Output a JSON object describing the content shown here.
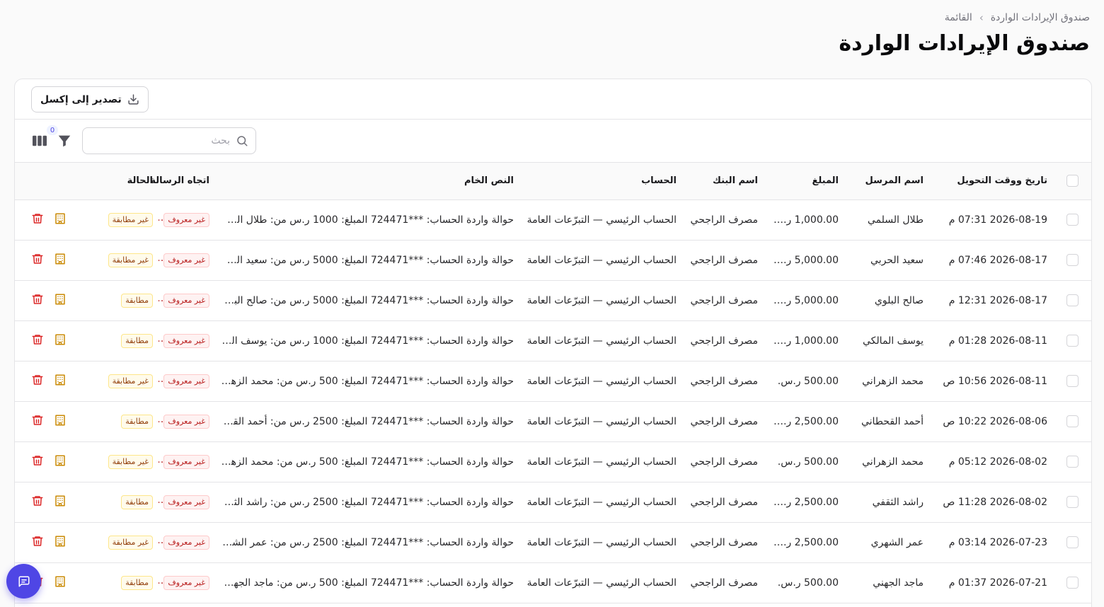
{
  "breadcrumb": {
    "parent": "صندوق الإيرادات الواردة",
    "separator": "›",
    "current": "القائمة"
  },
  "page_title": "صندوق الإيرادات الواردة",
  "toolbar": {
    "export_label": "تصدير إلى إكسل",
    "search_placeholder": "بحث",
    "filter_count": "0"
  },
  "table": {
    "headers": {
      "date": "تاريخ ووقت التحويل",
      "sender": "اسم المرسل",
      "amount": "المبلغ",
      "bank": "اسم البنك",
      "account": "الحساب",
      "raw": "النص الخام",
      "direction": "اتجاه الرسالة",
      "status": "الحالة"
    },
    "rows": [
      {
        "date": "2026-08-19 07:31 م",
        "sender": "طلال السلمي",
        "amount": "1,000.00 ر.س.",
        "bank": "مصرف الراجحي",
        "account": "الحساب الرئيسي — التبرّعات العامة",
        "raw": "حوالة واردة الحساب: ***724471 المبلغ: 1000 ر.س من: طلال السل...",
        "direction": "غير معروف",
        "status": "غير مطابقة",
        "status_kind": "match"
      },
      {
        "date": "2026-08-17 07:46 م",
        "sender": "سعيد الحربي",
        "amount": "5,000.00 ر.س.",
        "bank": "مصرف الراجحي",
        "account": "الحساب الرئيسي — التبرّعات العامة",
        "raw": "حوالة واردة الحساب: ***724471 المبلغ: 5000 ر.س من: سعيد الحر...",
        "direction": "غير معروف",
        "status": "غير مطابقة",
        "status_kind": "match"
      },
      {
        "date": "2026-08-17 12:31 م",
        "sender": "صالح البلوي",
        "amount": "5,000.00 ر.س.",
        "bank": "مصرف الراجحي",
        "account": "الحساب الرئيسي — التبرّعات العامة",
        "raw": "حوالة واردة الحساب: ***724471 المبلغ: 5000 ر.س من: صالح البل...",
        "direction": "غير معروف",
        "status": "مطابقة",
        "status_kind": "match"
      },
      {
        "date": "2026-08-11 01:28 م",
        "sender": "يوسف المالكي",
        "amount": "1,000.00 ر.س.",
        "bank": "مصرف الراجحي",
        "account": "الحساب الرئيسي — التبرّعات العامة",
        "raw": "حوالة واردة الحساب: ***724471 المبلغ: 1000 ر.س من: يوسف الما...",
        "direction": "غير معروف",
        "status": "مطابقة",
        "status_kind": "match"
      },
      {
        "date": "2026-08-11 10:56 ص",
        "sender": "محمد الزهراني",
        "amount": "500.00 ر.س.",
        "bank": "مصرف الراجحي",
        "account": "الحساب الرئيسي — التبرّعات العامة",
        "raw": "حوالة واردة الحساب: ***724471 المبلغ: 500 ر.س من: محمد الزهر...",
        "direction": "غير معروف",
        "status": "غير مطابقة",
        "status_kind": "match"
      },
      {
        "date": "2026-08-06 10:22 ص",
        "sender": "أحمد القحطاني",
        "amount": "2,500.00 ر.س.",
        "bank": "مصرف الراجحي",
        "account": "الحساب الرئيسي — التبرّعات العامة",
        "raw": "حوالة واردة الحساب: ***724471 المبلغ: 2500 ر.س من: أحمد القح...",
        "direction": "غير معروف",
        "status": "مطابقة",
        "status_kind": "match"
      },
      {
        "date": "2026-08-02 05:12 م",
        "sender": "محمد الزهراني",
        "amount": "500.00 ر.س.",
        "bank": "مصرف الراجحي",
        "account": "الحساب الرئيسي — التبرّعات العامة",
        "raw": "حوالة واردة الحساب: ***724471 المبلغ: 500 ر.س من: محمد الزهر...",
        "direction": "غير معروف",
        "status": "غير مطابقة",
        "status_kind": "match"
      },
      {
        "date": "2026-08-02 11:28 ص",
        "sender": "راشد الثقفي",
        "amount": "2,500.00 ر.س.",
        "bank": "مصرف الراجحي",
        "account": "الحساب الرئيسي — التبرّعات العامة",
        "raw": "حوالة واردة الحساب: ***724471 المبلغ: 2500 ر.س من: راشد الثق...",
        "direction": "غير معروف",
        "status": "مطابقة",
        "status_kind": "match"
      },
      {
        "date": "2026-07-23 03:14 م",
        "sender": "عمر الشهري",
        "amount": "2,500.00 ر.س.",
        "bank": "مصرف الراجحي",
        "account": "الحساب الرئيسي — التبرّعات العامة",
        "raw": "حوالة واردة الحساب: ***724471 المبلغ: 2500 ر.س من: عمر الشهر...",
        "direction": "غير معروف",
        "status": "غير مطابقة",
        "status_kind": "match"
      },
      {
        "date": "2026-07-21 01:37 م",
        "sender": "ماجد الجهني",
        "amount": "500.00 ر.س.",
        "bank": "مصرف الراجحي",
        "account": "الحساب الرئيسي — التبرّعات العامة",
        "raw": "حوالة واردة الحساب: ***724471 المبلغ: 500 ر.س من: ماجد الجهن...",
        "direction": "غير معروف",
        "status": "مطابقة",
        "status_kind": "match"
      }
    ]
  },
  "colors": {
    "accent": "#4f46e5",
    "delete_icon": "#dc2626",
    "building_icon": "#ca8a04"
  },
  "icons": {
    "export": "download-icon",
    "search": "search-icon",
    "filter": "filter-icon",
    "columns": "columns-icon",
    "delete": "trash-icon",
    "link": "building-icon",
    "chat": "chat-icon"
  }
}
